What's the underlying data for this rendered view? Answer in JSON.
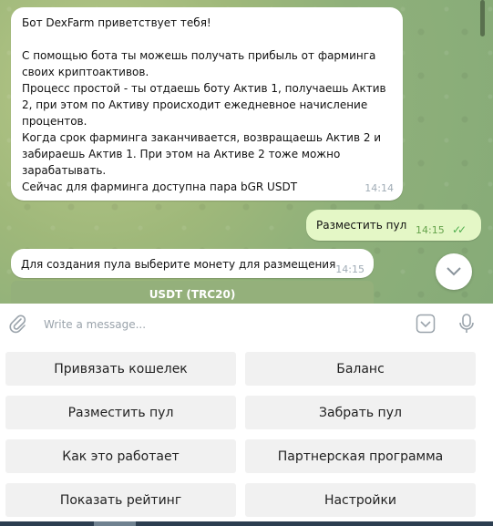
{
  "messages": {
    "welcome": {
      "text": "Бот DexFarm приветствует тебя!\n\nС помощью бота ты можешь получать прибыль от фарминга своих криптоактивов.\nПроцесс простой - ты отдаешь боту Актив 1, получаешь Актив 2, при этом по Активу происходит ежедневное начисление процентов.\nКогда срок фарминга заканчивается, возвращаешь Актив 2 и забираешь Актив 1. При этом на Активе 2 тоже можно зарабатывать.\nСейчас для фарминга доступна пара bGR USDT",
      "time": "14:14"
    },
    "outgoing": {
      "text": "Разместить пул",
      "time": "14:15",
      "checks": "✓✓"
    },
    "prompt": {
      "text": "Для создания пула выберите монету для размещения",
      "time": "14:15"
    }
  },
  "inline_button": {
    "label": "USDT (TRC20)"
  },
  "composer": {
    "placeholder": "Write a message..."
  },
  "keyboard": {
    "buttons": [
      "Привязать кошелек",
      "Баланс",
      "Разместить пул",
      "Забрать пул",
      "Как это работает",
      "Партнерская программа",
      "Показать рейтинг",
      "Настройки"
    ]
  },
  "icons": {
    "attach": "paperclip-icon",
    "keyboard": "keyboard-toggle-icon",
    "mic": "microphone-icon",
    "scroll": "chevron-down-icon"
  },
  "colors": {
    "outgoing_bubble": "#e4f7c6",
    "checks": "#4fae4e",
    "inline_button": "#94b07b",
    "keyboard_button": "#f1f1f1"
  }
}
